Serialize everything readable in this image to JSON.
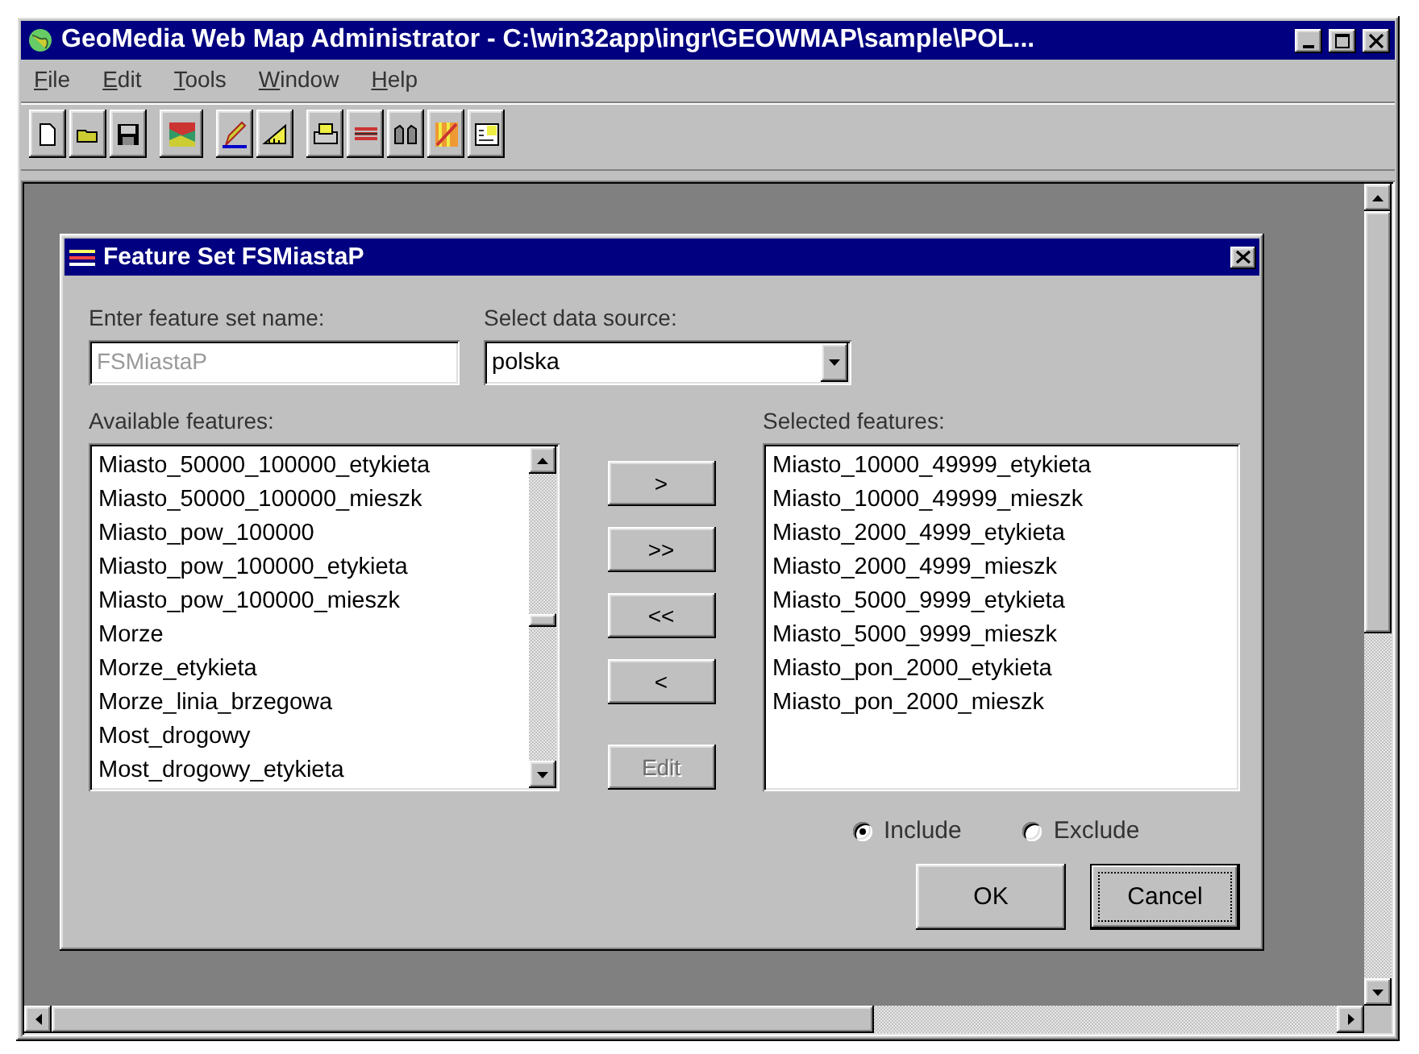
{
  "window": {
    "title": "GeoMedia Web Map Administrator - C:\\win32app\\ingr\\GEOWMAP\\sample\\POL..."
  },
  "menu": [
    "File",
    "Edit",
    "Tools",
    "Window",
    "Help"
  ],
  "dialog": {
    "title": "Feature Set FSMiastaP",
    "name_field": {
      "label": "Enter feature set name:",
      "value": "FSMiastaP",
      "disabled": true
    },
    "data_source": {
      "label": "Select data source:",
      "value": "polska"
    },
    "available": {
      "label": "Available features:",
      "items": [
        "Miasto_50000_100000_etykieta",
        "Miasto_50000_100000_mieszk",
        "Miasto_pow_100000",
        "Miasto_pow_100000_etykieta",
        "Miasto_pow_100000_mieszk",
        "Morze",
        "Morze_etykieta",
        "Morze_linia_brzegowa",
        "Most_drogowy",
        "Most_drogowy_etykieta"
      ]
    },
    "transfer_buttons": [
      {
        "label": ">",
        "disabled": false
      },
      {
        "label": ">>",
        "disabled": false
      },
      {
        "label": "<<",
        "disabled": false
      },
      {
        "label": "<",
        "disabled": false
      },
      {
        "label": "Edit",
        "disabled": true
      }
    ],
    "selected": {
      "label": "Selected features:",
      "items": [
        "Miasto_10000_49999_etykieta",
        "Miasto_10000_49999_mieszk",
        "Miasto_2000_4999_etykieta",
        "Miasto_2000_4999_mieszk",
        "Miasto_5000_9999_etykieta",
        "Miasto_5000_9999_mieszk",
        "Miasto_pon_2000_etykieta",
        "Miasto_pon_2000_mieszk"
      ]
    },
    "mode": [
      {
        "label": "Include",
        "selected": true
      },
      {
        "label": "Exclude",
        "selected": false
      }
    ],
    "buttons": [
      {
        "label": "OK",
        "focused": false
      },
      {
        "label": "Cancel",
        "focused": true
      }
    ]
  }
}
